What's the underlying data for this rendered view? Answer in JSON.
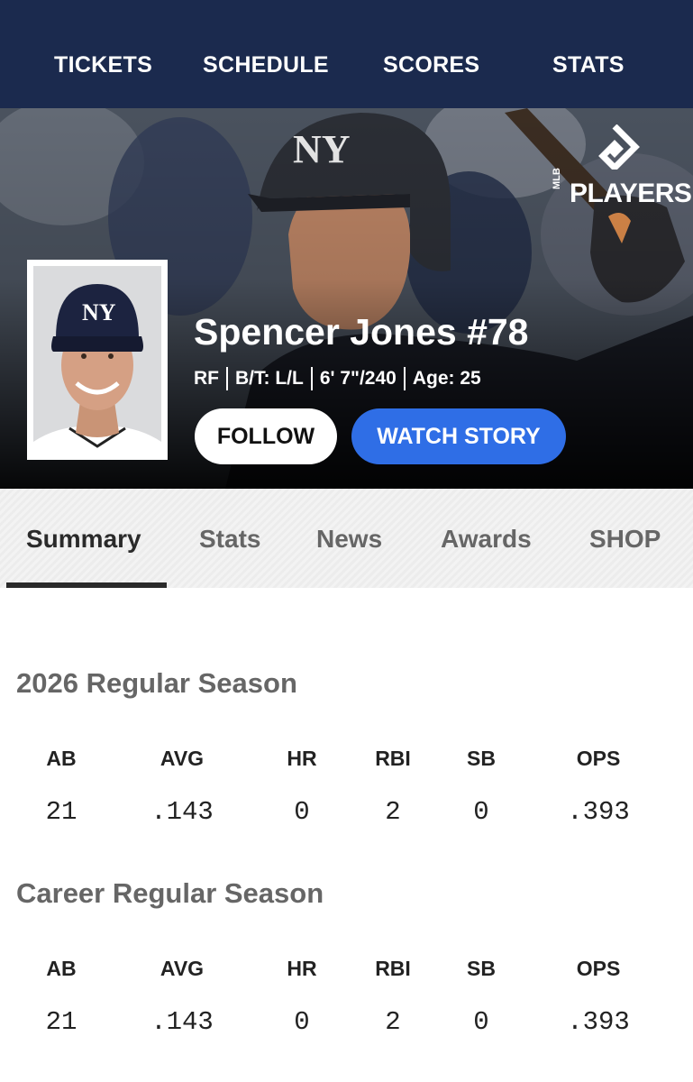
{
  "topnav": {
    "items": [
      {
        "label": "TICKETS"
      },
      {
        "label": "SCHEDULE"
      },
      {
        "label": "SCORES"
      },
      {
        "label": "STATS"
      }
    ]
  },
  "hero": {
    "logo_text": "PLAYERS",
    "logo_subtext": "MLB",
    "player_name": "Spencer Jones #78",
    "bio": {
      "position": "RF",
      "bats_throws": "B/T: L/L",
      "height_weight": "6' 7\"/240",
      "age": "Age: 25"
    },
    "follow_label": "FOLLOW",
    "watch_story_label": "WATCH STORY"
  },
  "tabs": [
    {
      "label": "Summary",
      "active": true
    },
    {
      "label": "Stats"
    },
    {
      "label": "News"
    },
    {
      "label": "Awards"
    },
    {
      "label": "SHOP"
    }
  ],
  "season_2026": {
    "title": "2026 Regular Season",
    "headers": [
      "AB",
      "AVG",
      "HR",
      "RBI",
      "SB",
      "OPS"
    ],
    "values": [
      "21",
      ".143",
      "0",
      "2",
      "0",
      ".393"
    ]
  },
  "career": {
    "title": "Career Regular Season",
    "headers": [
      "AB",
      "AVG",
      "HR",
      "RBI",
      "SB",
      "OPS"
    ],
    "values": [
      "21",
      ".143",
      "0",
      "2",
      "0",
      ".393"
    ]
  },
  "colors": {
    "nav_bg": "#1b2a4e",
    "accent_blue": "#2f6ee6",
    "tab_active": "#2a2a2a",
    "muted_text": "#666666"
  }
}
